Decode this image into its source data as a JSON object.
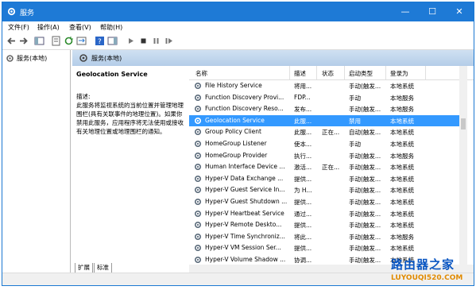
{
  "window": {
    "title": "服务",
    "titlebar_color": "#1e7ad6",
    "controls": [
      "—",
      "☐",
      "✕"
    ]
  },
  "menu": [
    "文件(F)",
    "操作(A)",
    "查看(V)",
    "帮助(H)"
  ],
  "tree": {
    "root_label": "服务(本地)"
  },
  "pane_header": "服务(本地)",
  "detail": {
    "service_name": "Geolocation Service",
    "desc_label": "描述:",
    "desc_text": "此服务将监视系统的当前位置并管理地理围栏(具有关联事件的地理位置)。如果你禁用此服务，应用程序将无法使用或接收有关地理位置或地理围栏的通知。"
  },
  "tabs": [
    "扩展",
    "标准"
  ],
  "table": {
    "columns": [
      "名称",
      "描述",
      "状态",
      "启动类型",
      "登录为"
    ],
    "rows": [
      {
        "name": "File History Service",
        "desc": "将用...",
        "status": "",
        "startup": "手动(触发...",
        "logon": "本地系统",
        "selected": false
      },
      {
        "name": "Function Discovery Provi...",
        "desc": "FDP...",
        "status": "",
        "startup": "手动",
        "logon": "本地服务",
        "selected": false
      },
      {
        "name": "Function Discovery Reso...",
        "desc": "发布...",
        "status": "",
        "startup": "手动(触发...",
        "logon": "本地服务",
        "selected": false
      },
      {
        "name": "Geolocation Service",
        "desc": "此服...",
        "status": "",
        "startup": "禁用",
        "logon": "本地系统",
        "selected": true
      },
      {
        "name": "Group Policy Client",
        "desc": "此服...",
        "status": "正在...",
        "startup": "自动(触发...",
        "logon": "本地系统",
        "selected": false
      },
      {
        "name": "HomeGroup Listener",
        "desc": "使本...",
        "status": "",
        "startup": "手动",
        "logon": "本地系统",
        "selected": false
      },
      {
        "name": "HomeGroup Provider",
        "desc": "执行...",
        "status": "",
        "startup": "手动(触发...",
        "logon": "本地服务",
        "selected": false
      },
      {
        "name": "Human Interface Device ...",
        "desc": "激活...",
        "status": "正在...",
        "startup": "手动(触发...",
        "logon": "本地系统",
        "selected": false
      },
      {
        "name": "Hyper-V Data Exchange ...",
        "desc": "提供...",
        "status": "",
        "startup": "手动(触发...",
        "logon": "本地系统",
        "selected": false
      },
      {
        "name": "Hyper-V Guest Service In...",
        "desc": "为 H...",
        "status": "",
        "startup": "手动(触发...",
        "logon": "本地系统",
        "selected": false
      },
      {
        "name": "Hyper-V Guest Shutdown ...",
        "desc": "提供...",
        "status": "",
        "startup": "手动(触发...",
        "logon": "本地系统",
        "selected": false
      },
      {
        "name": "Hyper-V Heartbeat Service",
        "desc": "通过...",
        "status": "",
        "startup": "手动(触发...",
        "logon": "本地系统",
        "selected": false
      },
      {
        "name": "Hyper-V Remote Deskto...",
        "desc": "提供...",
        "status": "",
        "startup": "手动(触发...",
        "logon": "本地系统",
        "selected": false
      },
      {
        "name": "Hyper-V Time Synchroniz...",
        "desc": "将此...",
        "status": "",
        "startup": "手动(触发...",
        "logon": "本地服务",
        "selected": false
      },
      {
        "name": "Hyper-V VM Session Ser...",
        "desc": "提供...",
        "status": "",
        "startup": "手动(触发...",
        "logon": "本地系统",
        "selected": false
      },
      {
        "name": "Hyper-V Volume Shadow ...",
        "desc": "协调...",
        "status": "",
        "startup": "手动(触发...",
        "logon": "本地系统",
        "selected": false
      }
    ]
  },
  "watermark": {
    "main": "路由器之家",
    "url": "LUYOUQI520.COM"
  },
  "colors": {
    "selection": "#3399ff",
    "pane_header": "#b4cde8"
  }
}
